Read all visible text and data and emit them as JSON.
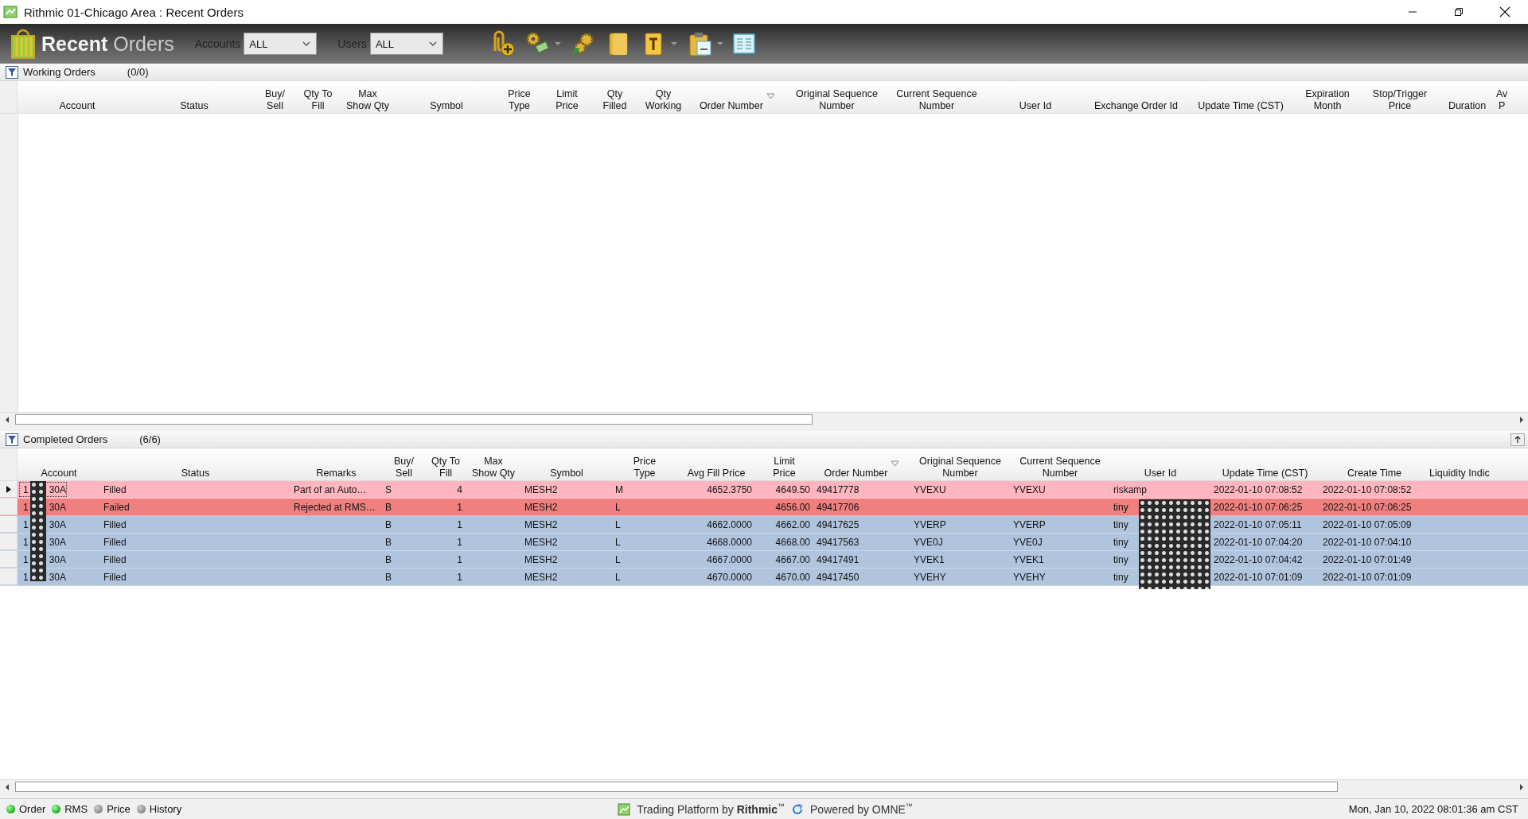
{
  "window": {
    "title": "Rithmic 01-Chicago Area : Recent Orders"
  },
  "toolbar": {
    "logo_bold": "Recent",
    "logo_light": "Orders",
    "filters": [
      {
        "label": "Accounts",
        "value": "ALL"
      },
      {
        "label": "Users",
        "value": "ALL"
      }
    ],
    "buttons": [
      {
        "kind": "clip",
        "has_menu": false
      },
      {
        "kind": "gears",
        "has_menu": true
      },
      {
        "kind": "gears-arrow",
        "has_menu": false
      },
      {
        "kind": "folder",
        "has_menu": false
      },
      {
        "kind": "text-doc",
        "has_menu": true
      },
      {
        "kind": "clipboard",
        "has_menu": true
      },
      {
        "kind": "list",
        "has_menu": false
      }
    ]
  },
  "working": {
    "title": "Working Orders",
    "count": "(0/0)",
    "columns": [
      {
        "label": "Account",
        "sorted": false
      },
      {
        "label": "Status",
        "sorted": false
      },
      {
        "label": "Buy/\nSell",
        "sorted": false
      },
      {
        "label": "Qty To\nFill",
        "sorted": false
      },
      {
        "label": "Max\nShow Qty",
        "sorted": false
      },
      {
        "label": "Symbol",
        "sorted": false
      },
      {
        "label": "Price\nType",
        "sorted": false
      },
      {
        "label": "Limit\nPrice",
        "sorted": false
      },
      {
        "label": "Qty\nFilled",
        "sorted": false
      },
      {
        "label": "Qty\nWorking",
        "sorted": false
      },
      {
        "label": "Order Number",
        "sorted": true
      },
      {
        "label": "Original Sequence\nNumber",
        "sorted": false
      },
      {
        "label": "Current Sequence\nNumber",
        "sorted": false
      },
      {
        "label": "User Id",
        "sorted": false
      },
      {
        "label": "Exchange Order Id",
        "sorted": false
      },
      {
        "label": "Update Time (CST)",
        "sorted": false
      },
      {
        "label": "Expiration\nMonth",
        "sorted": false
      },
      {
        "label": "Stop/Trigger\nPrice",
        "sorted": false
      },
      {
        "label": "Duration",
        "sorted": false
      },
      {
        "label": "Av\nP",
        "sorted": false
      }
    ]
  },
  "completed": {
    "title": "Completed Orders",
    "count": "(6/6)",
    "columns": [
      {
        "label": "Account",
        "sorted": false
      },
      {
        "label": "Status",
        "sorted": false
      },
      {
        "label": "Remarks",
        "sorted": false
      },
      {
        "label": "Buy/\nSell",
        "sorted": false
      },
      {
        "label": "Qty To\nFill",
        "sorted": false
      },
      {
        "label": "Max\nShow Qty",
        "sorted": false
      },
      {
        "label": "Symbol",
        "sorted": false
      },
      {
        "label": "Price\nType",
        "sorted": false
      },
      {
        "label": "Avg Fill Price",
        "sorted": false
      },
      {
        "label": "Limit\nPrice",
        "sorted": false
      },
      {
        "label": "Order Number",
        "sorted": true
      },
      {
        "label": "Original Sequence\nNumber",
        "sorted": false
      },
      {
        "label": "Current Sequence\nNumber",
        "sorted": false
      },
      {
        "label": "User Id",
        "sorted": false
      },
      {
        "label": "Update Time (CST)",
        "sorted": false
      },
      {
        "label": "Create Time",
        "sorted": false
      },
      {
        "label": "Liquidity Indic",
        "sorted": false
      }
    ],
    "rows": [
      {
        "selected": true,
        "color": "#ffb6c1",
        "account_prefix": "1",
        "cells": [
          "30A",
          "Filled",
          "Part of an Auto…",
          "S",
          "4",
          null,
          "MESH2",
          "M",
          "4652.3750",
          "4649.50",
          "49417778",
          "YVEXU",
          "YVEXU",
          "riskamp",
          "2022-01-10 07:08:52",
          "2022-01-10 07:08:52",
          null
        ]
      },
      {
        "selected": false,
        "color": "#f08080",
        "account_prefix": "1",
        "cells": [
          "30A",
          "Failed",
          "Rejected at RMS…",
          "B",
          "1",
          null,
          "MESH2",
          "L",
          null,
          "4656.00",
          "49417706",
          null,
          null,
          "tiny",
          "2022-01-10 07:06:25",
          "2022-01-10 07:06:25",
          null
        ]
      },
      {
        "selected": false,
        "color": "#b0c4de",
        "account_prefix": "1",
        "cells": [
          "30A",
          "Filled",
          null,
          "B",
          "1",
          null,
          "MESH2",
          "L",
          "4662.0000",
          "4662.00",
          "49417625",
          "YVERP",
          "YVERP",
          "tiny",
          "2022-01-10 07:05:11",
          "2022-01-10 07:05:09",
          null
        ]
      },
      {
        "selected": false,
        "color": "#b0c4de",
        "account_prefix": "1",
        "cells": [
          "30A",
          "Filled",
          null,
          "B",
          "1",
          null,
          "MESH2",
          "L",
          "4668.0000",
          "4668.00",
          "49417563",
          "YVE0J",
          "YVE0J",
          "tiny",
          "2022-01-10 07:04:20",
          "2022-01-10 07:04:10",
          null
        ]
      },
      {
        "selected": false,
        "color": "#b0c4de",
        "account_prefix": "1",
        "cells": [
          "30A",
          "Filled",
          null,
          "B",
          "1",
          null,
          "MESH2",
          "L",
          "4667.0000",
          "4667.00",
          "49417491",
          "YVEK1",
          "YVEK1",
          "tiny",
          "2022-01-10 07:04:42",
          "2022-01-10 07:01:49",
          null
        ]
      },
      {
        "selected": false,
        "color": "#b0c4de",
        "account_prefix": "1",
        "cells": [
          "30A",
          "Filled",
          null,
          "B",
          "1",
          null,
          "MESH2",
          "L",
          "4670.0000",
          "4670.00",
          "49417450",
          "YVEHY",
          "YVEHY",
          "tiny",
          "2022-01-10 07:01:09",
          "2022-01-10 07:01:09",
          null
        ]
      }
    ]
  },
  "status_bar": {
    "indicators": [
      {
        "label": "Order",
        "on": true
      },
      {
        "label": "RMS",
        "on": true
      },
      {
        "label": "Price",
        "on": false
      },
      {
        "label": "History",
        "on": false
      }
    ],
    "platform": "Trading Platform by **Rithmic**$^{™}$",
    "powered": "Powered by OMNE$^{™}$",
    "datetime": "Mon, Jan 10, 2022 08:01:36 am CST"
  }
}
